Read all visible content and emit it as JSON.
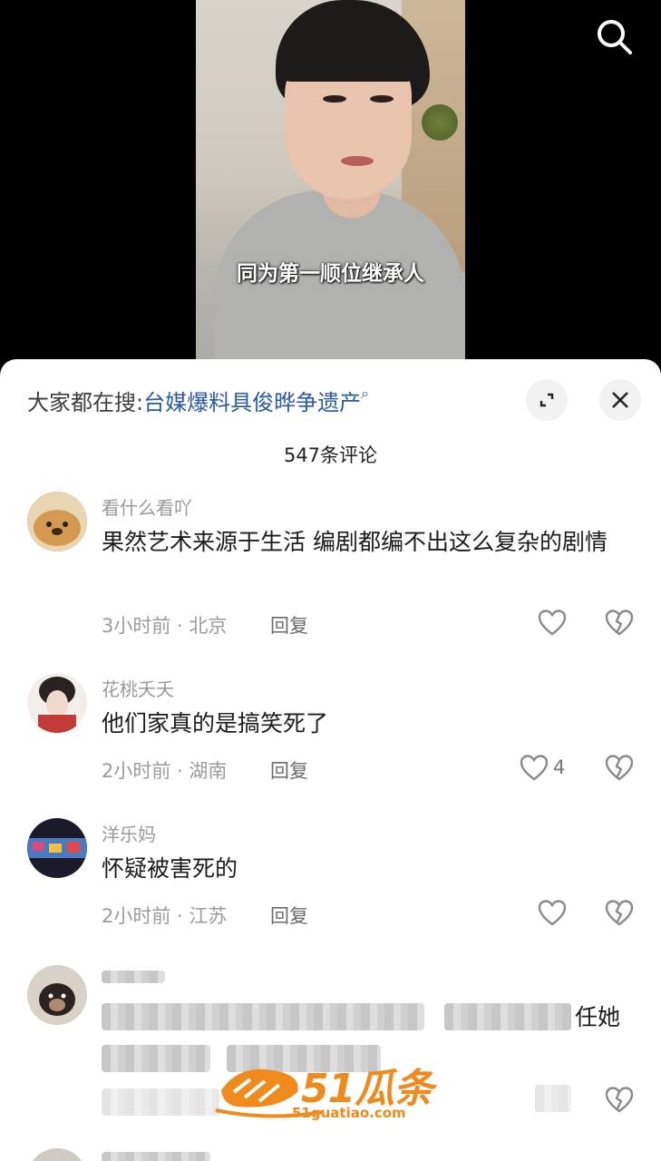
{
  "video": {
    "subtitle": "同为第一顺位继承人"
  },
  "sheet": {
    "search_label": "大家都在搜:",
    "search_term": "台媒爆料具俊晔争遗产",
    "comment_count": "547条评论"
  },
  "comments": [
    {
      "user": "看什么看吖",
      "text": "果然艺术来源于生活 编剧都编不出这么复杂的剧情",
      "time": "3小时前 · 北京",
      "reply": "回复",
      "likes": ""
    },
    {
      "user": "花桃夭夭",
      "text": "他们家真的是搞笑死了",
      "time": "2小时前 · 湖南",
      "reply": "回复",
      "likes": "4"
    },
    {
      "user": "洋乐妈",
      "text": "怀疑被害死的",
      "time": "2小时前 · 江苏",
      "reply": "回复",
      "likes": ""
    },
    {
      "text_tail": "任她"
    }
  ],
  "watermark": {
    "brand": "51瓜条",
    "url": "51guatiao.com"
  },
  "colors": {
    "link": "#2a5aa8",
    "watermark": "#f08a1c"
  }
}
